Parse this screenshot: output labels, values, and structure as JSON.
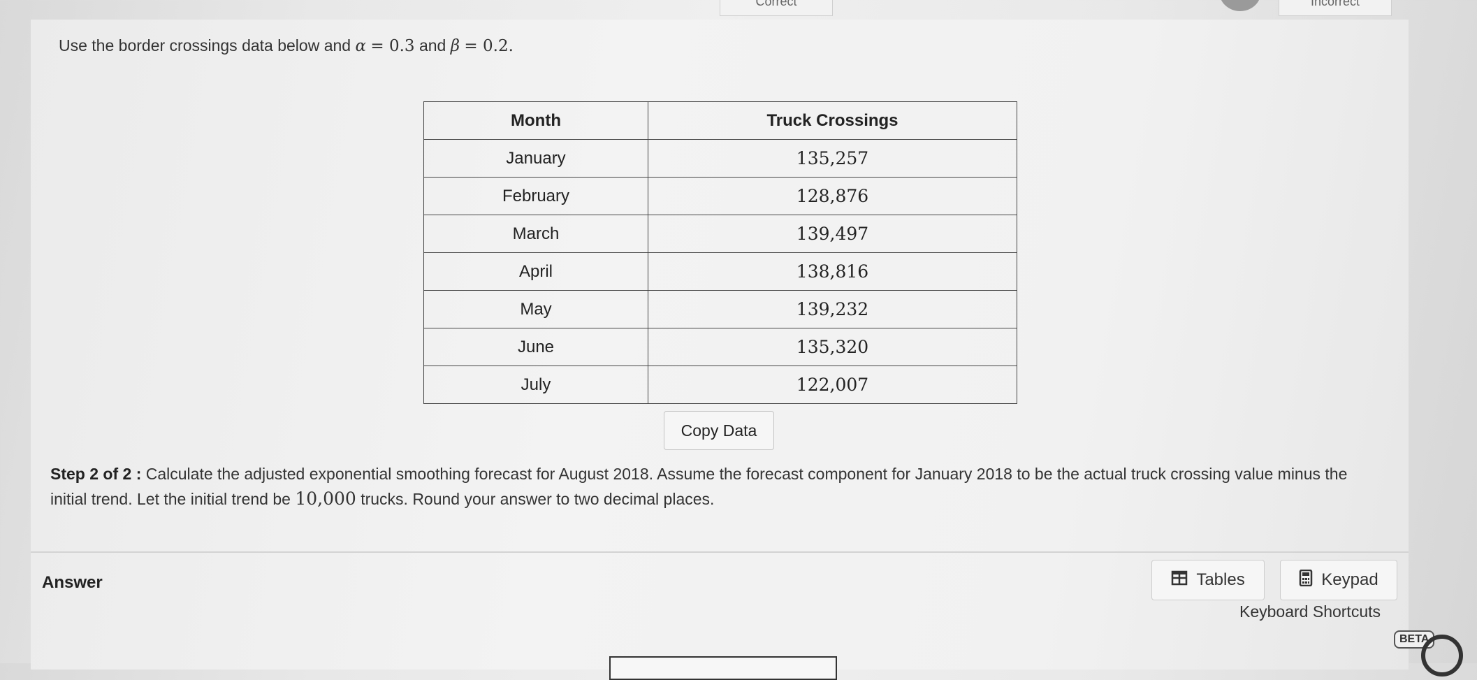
{
  "header": {
    "tab_correct": "Correct",
    "tab_incorrect": "Incorrect"
  },
  "question": {
    "prefix": "Use the border crossings data below and",
    "alpha_symbol": "α",
    "alpha_value": "= 0.3",
    "conj": "and",
    "beta_symbol": "β",
    "beta_value": "= 0.2."
  },
  "table": {
    "headers": [
      "Month",
      "Truck Crossings"
    ],
    "rows": [
      [
        "January",
        "135,257"
      ],
      [
        "February",
        "128,876"
      ],
      [
        "March",
        "139,497"
      ],
      [
        "April",
        "138,816"
      ],
      [
        "May",
        "139,232"
      ],
      [
        "June",
        "135,320"
      ],
      [
        "July",
        "122,007"
      ]
    ]
  },
  "copy_data_label": "Copy Data",
  "step": {
    "lead": "Step 2 of 2 :",
    "text_part1": "Calculate the adjusted exponential smoothing forecast for August 2018. Assume the forecast component for January 2018 to be the actual truck crossing value minus the initial trend. Let the initial trend be",
    "trend_value": "10,000",
    "text_part2": "trucks. Round your answer to two decimal places."
  },
  "answer": {
    "label": "Answer",
    "tables_label": "Tables",
    "keypad_label": "Keypad",
    "shortcuts_label": "Keyboard Shortcuts",
    "beta_badge": "BETA"
  },
  "icons": {
    "tables": "table-grid-icon",
    "keypad": "calculator-icon"
  }
}
